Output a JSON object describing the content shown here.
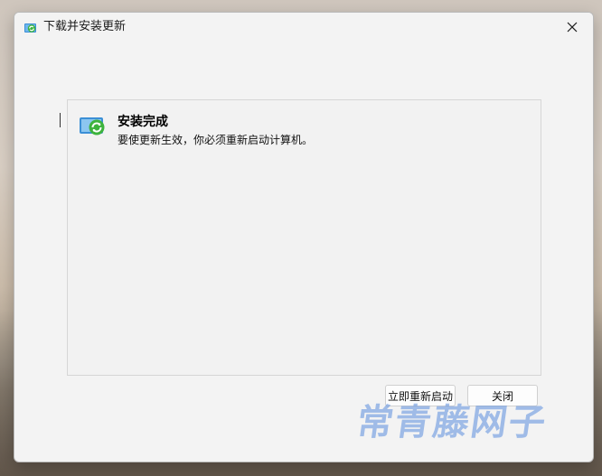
{
  "window": {
    "title": "下载并安装更新",
    "app_icon": "windows-update-icon",
    "close_icon": "close-icon"
  },
  "panel": {
    "icon": "update-complete-icon",
    "heading": "安装完成",
    "message": "要使更新生效，你必须重新启动计算机。"
  },
  "buttons": {
    "restart_label": "立即重新启动",
    "close_label": "关闭"
  },
  "watermark": {
    "text": "常青藤网子"
  },
  "colors": {
    "window_bg": "#f3f3f3",
    "panel_border": "#d6d6d6",
    "icon_green": "#3db33d",
    "icon_blue": "#3b8fd6",
    "watermark": "#5a8cdc"
  }
}
